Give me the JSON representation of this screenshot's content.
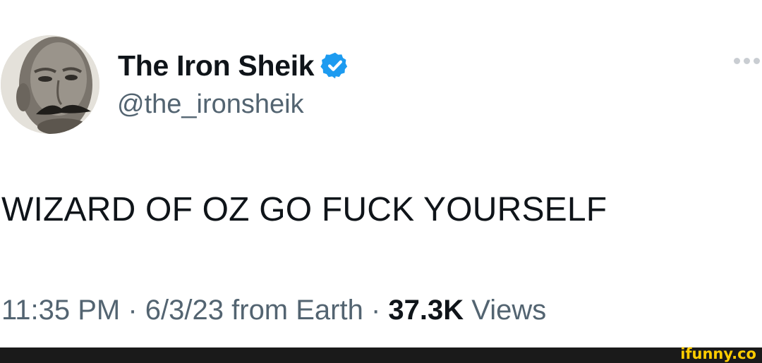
{
  "author": {
    "display_name": "The Iron Sheik",
    "handle": "@the_ironsheik",
    "verified_icon": "verified-badge-icon",
    "verified_color": "#1d9bf0"
  },
  "tweet": {
    "text": "WIZARD OF OZ GO FUCK YOURSELF"
  },
  "meta": {
    "time": "11:35 PM",
    "sep1": " · ",
    "date": "6/3/23",
    "source": " from Earth",
    "sep2": " · ",
    "views_count": "37.3K",
    "views_label": " Views"
  },
  "watermark": {
    "text": "ifunny.co",
    "color": "#ffcc00"
  },
  "colors": {
    "text_primary": "#0f1419",
    "text_secondary": "#536471",
    "background": "#ffffff"
  }
}
